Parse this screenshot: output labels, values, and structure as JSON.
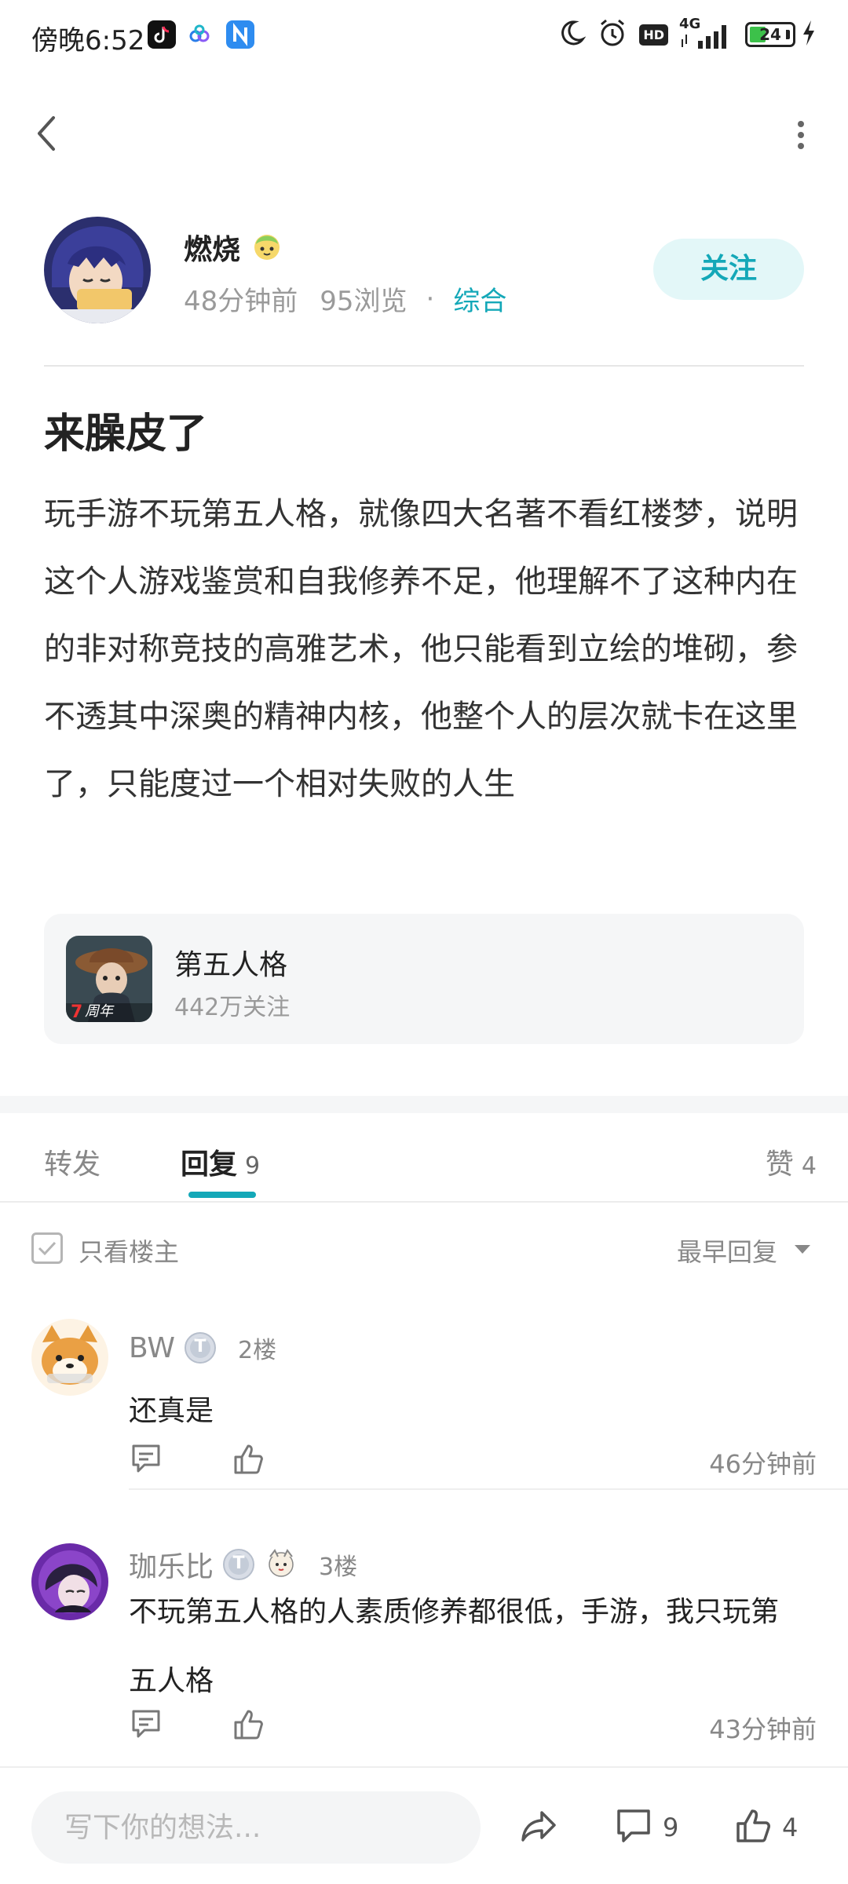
{
  "status_bar": {
    "time": "傍晚6:52",
    "network": "4G",
    "hd": "HD",
    "battery": "24",
    "app_icons": [
      "tiktok-icon",
      "cloud-app-icon",
      "n-app-icon"
    ],
    "status_icons": [
      "moon-icon",
      "alarm-icon",
      "hd-icon",
      "signal-icon",
      "battery-icon",
      "charging-icon"
    ]
  },
  "nav": {
    "back_icon": "back-arrow-icon",
    "more_icon": "more-vertical-icon"
  },
  "author": {
    "name": "燃烧",
    "time_ago": "48分钟前",
    "views": "95浏览",
    "separator": "·",
    "category": "综合",
    "follow_label": "关注"
  },
  "post": {
    "title": "来臊皮了",
    "body": "玩手游不玩第五人格，就像四大名著不看红楼梦，说明这个人游戏鉴赏和自我修养不足，他理解不了这种内在的非对称竞技的高雅艺术，他只能看到立绘的堆砌，参不透其中深奥的精神内核，他整个人的层次就卡在这里了，只能度过一个相对失败的人生"
  },
  "game_card": {
    "name": "第五人格",
    "followers": "442万关注",
    "badge": "周年"
  },
  "tabs": {
    "forward": "转发",
    "reply": "回复",
    "reply_count": "9",
    "likes": "赞",
    "likes_count": "4"
  },
  "filter": {
    "owner_only": "只看楼主",
    "sort": "最早回复"
  },
  "comments": [
    {
      "name": "BW",
      "level": "T",
      "floor": "2楼",
      "text": "还真是",
      "time": "46分钟前"
    },
    {
      "name": "珈乐比",
      "level": "T",
      "floor": "3楼",
      "text": "不玩第五人格的人素质修养都很低，手游，我只玩第五人格",
      "time": "43分钟前"
    }
  ],
  "bottom_bar": {
    "placeholder": "写下你的想法...",
    "comment_count": "9",
    "like_count": "4"
  },
  "colors": {
    "accent": "#14a8b8",
    "follow_bg": "#e3f7f8",
    "muted_text": "#9a9a9a",
    "card_bg": "#f5f6f7"
  }
}
